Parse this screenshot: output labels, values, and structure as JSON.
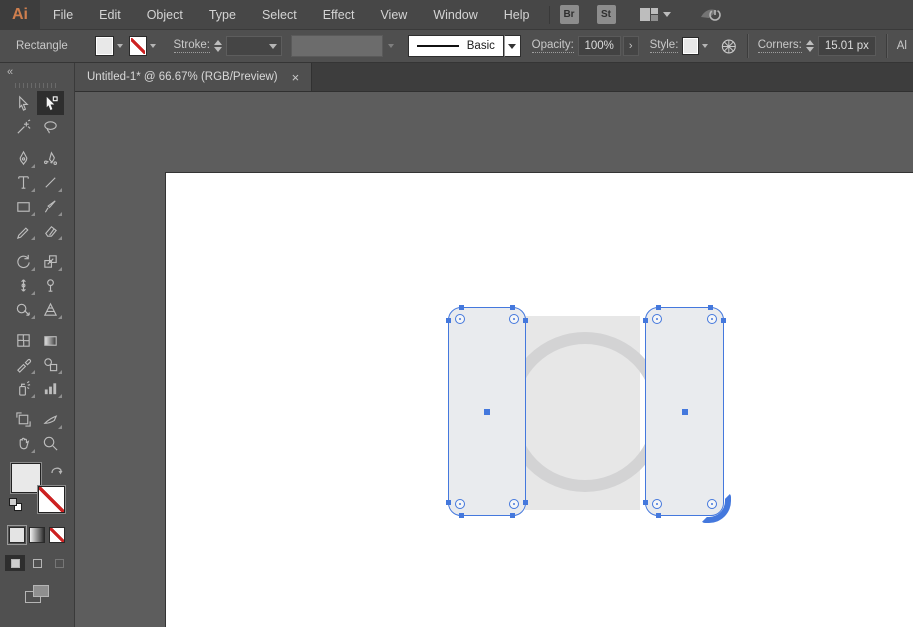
{
  "app": {
    "logo": "Ai"
  },
  "menu_bar": {
    "items": [
      "File",
      "Edit",
      "Object",
      "Type",
      "Select",
      "Effect",
      "View",
      "Window",
      "Help"
    ],
    "bridge_button": "Br",
    "stock_button": "St",
    "right_icons": [
      "workspace-switcher-icon",
      "chevron-down-icon",
      "cc-sync-icon"
    ]
  },
  "control_bar": {
    "context_label": "Rectangle",
    "fill_swatch": "light-gray",
    "stroke_swatch": "none",
    "stroke_label": "Stroke:",
    "brush_style": "Basic",
    "opacity_label": "Opacity:",
    "opacity_value": "100%",
    "style_label": "Style:",
    "recolor_icon": "recolor-artwork-wheel-icon",
    "corners_label": "Corners:",
    "corners_value": "15.01 px",
    "truncated_right_label": "Al"
  },
  "tab_bar": {
    "tabs": [
      {
        "title": "Untitled-1* @ 66.67% (RGB/Preview)",
        "close_glyph": "×",
        "active": true
      }
    ]
  },
  "toolbar": {
    "collapse_glyph": "«",
    "active_tool": "direct-selection-tool",
    "tools": [
      "selection-tool",
      "direct-selection-tool",
      "magic-wand-tool",
      "lasso-tool",
      "pen-tool",
      "curvature-tool",
      "type-tool",
      "line-segment-tool",
      "rectangle-tool",
      "paintbrush-tool",
      "shaper-tool",
      "eraser-tool",
      "rotate-tool",
      "scale-tool",
      "width-tool",
      "puppet-warp-tool",
      "shape-builder-tool",
      "perspective-grid-tool",
      "mesh-tool",
      "gradient-tool",
      "eyedropper-tool",
      "blend-tool",
      "symbol-sprayer-tool",
      "column-graph-tool",
      "artboard-tool",
      "slice-tool",
      "hand-tool",
      "zoom-tool"
    ],
    "fill_stroke": {
      "fill": "light-gray",
      "stroke": "none"
    },
    "color_type_buttons": [
      "color",
      "gradient",
      "none"
    ],
    "drawing_modes": [
      "draw-normal",
      "draw-behind",
      "draw-inside"
    ],
    "active_drawing_mode": "draw-normal",
    "screen_mode_button": "change-screen-mode"
  },
  "canvas": {
    "zoom_level": "66.67%",
    "color_mode": "RGB/Preview",
    "objects": [
      {
        "type": "square",
        "fill": "#e7e7e7"
      },
      {
        "type": "circle-ring",
        "stroke": "#d3d3d4"
      },
      {
        "type": "rounded-rectangle",
        "selected": true,
        "position": "left"
      },
      {
        "type": "rounded-rectangle",
        "selected": true,
        "position": "right",
        "corner_drag_active": "bottom-right"
      }
    ]
  },
  "colors": {
    "menu_bar_bg": "#474747",
    "panel_bg": "#4f4f4f",
    "tab_bar_bg": "#3d3d3d",
    "pasteboard": "#5d5d5d",
    "artboard": "#ffffff",
    "selection_blue": "#4478dd",
    "logo_orange": "#cf7f4e",
    "shape_fill": "#e9ebee",
    "none_red": "#cc2222"
  }
}
